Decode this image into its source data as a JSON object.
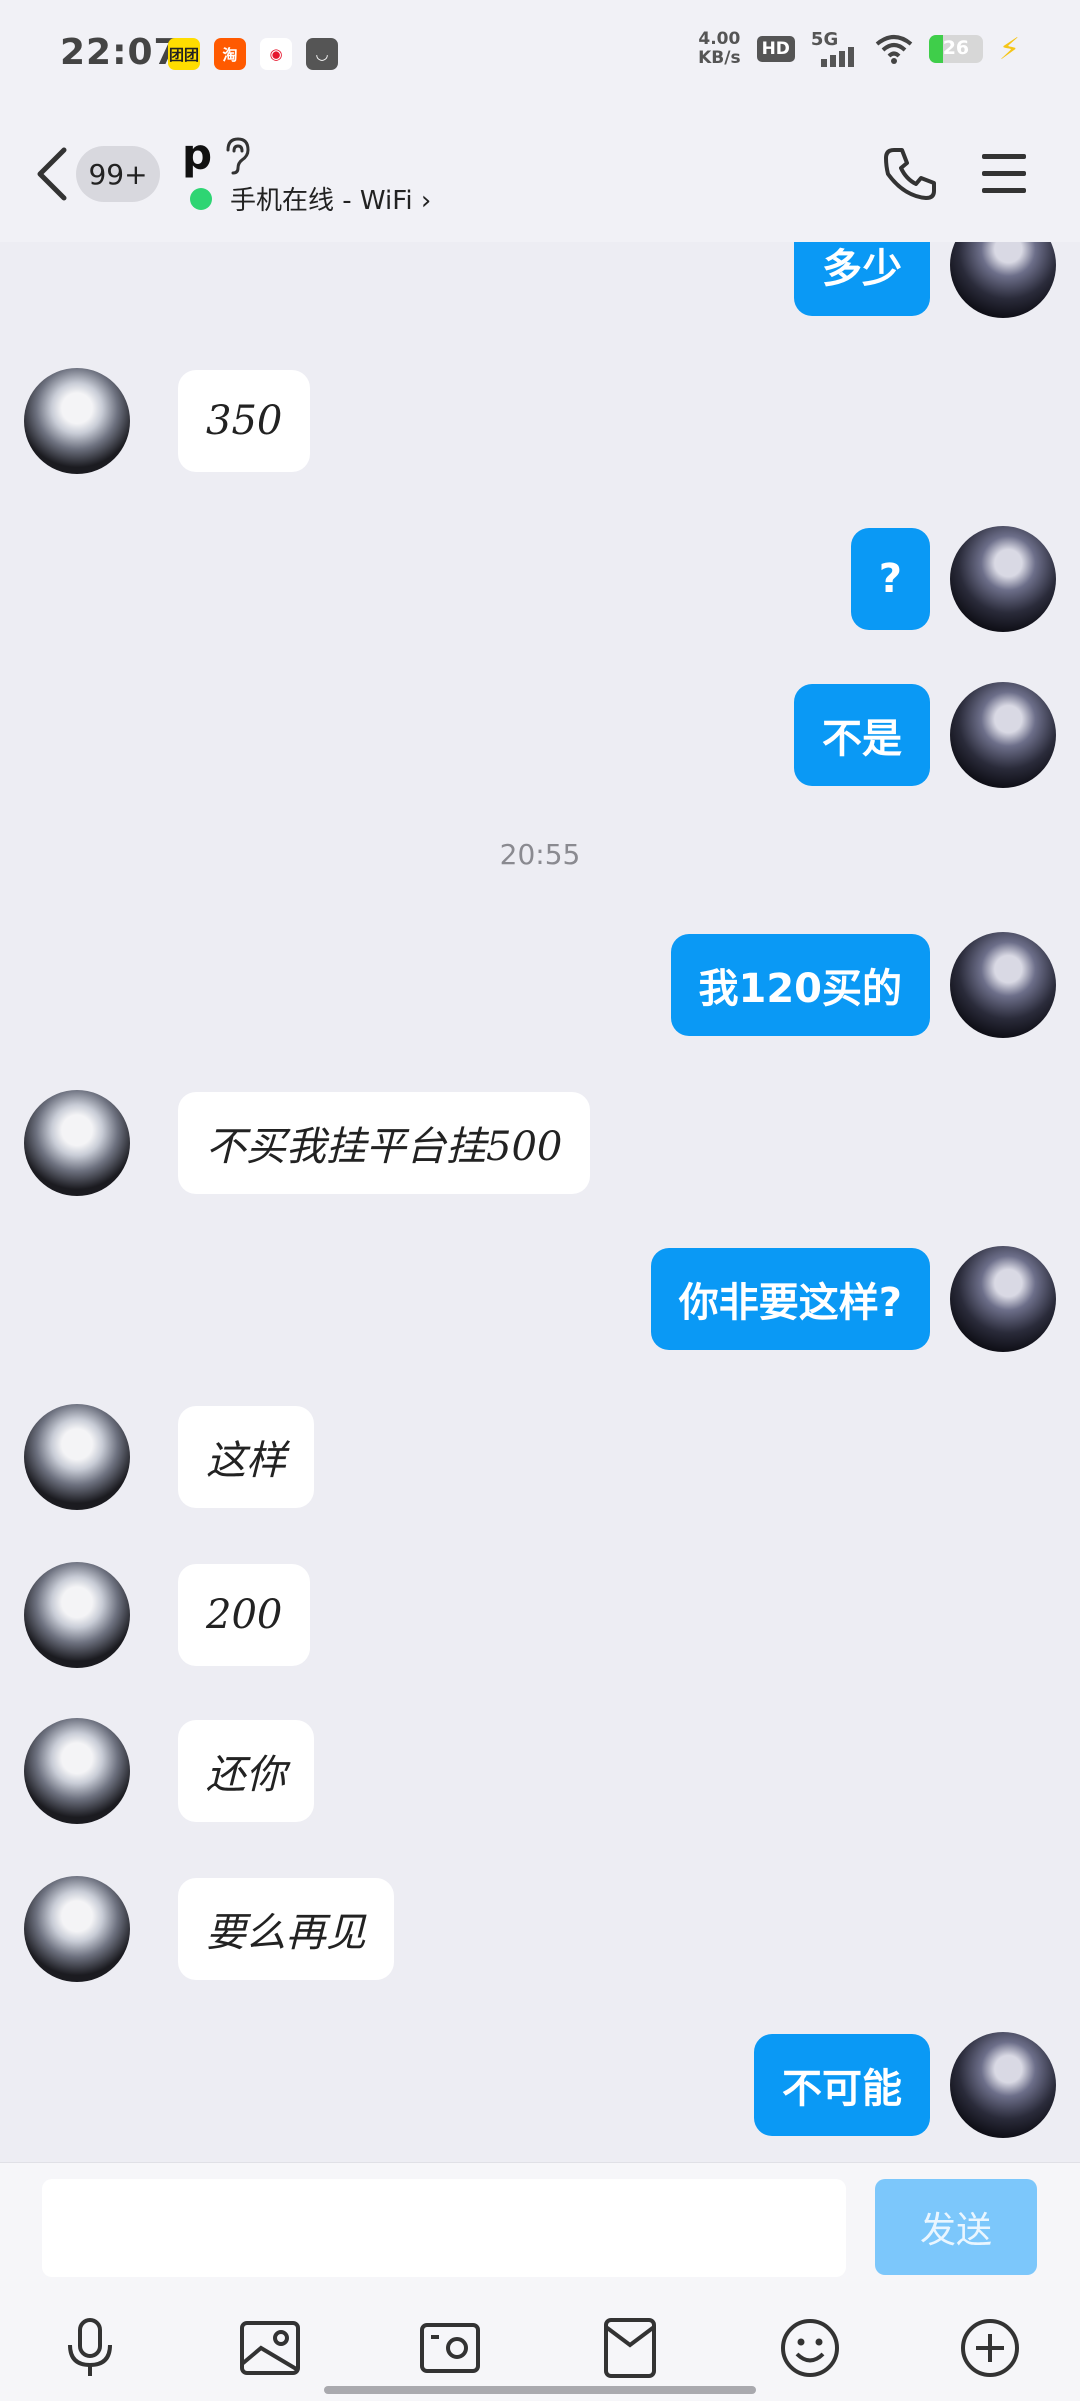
{
  "status_bar": {
    "time": "22:07",
    "app_icons": [
      {
        "name": "meituan-app-icon",
        "label": "团团",
        "bg": "#ffdd00",
        "fg": "#222"
      },
      {
        "name": "taobao-app-icon",
        "label": "淘",
        "bg": "#ff5a00",
        "fg": "#fff"
      },
      {
        "name": "weibo-app-icon",
        "label": "◉",
        "bg": "#ffffff",
        "fg": "#e6162d"
      },
      {
        "name": "bag-app-icon",
        "label": "◡",
        "bg": "#555555",
        "fg": "#fff"
      }
    ],
    "net_speed": "4.00",
    "net_unit": "KB/s",
    "hd": "HD",
    "signal": "5G",
    "battery": "26",
    "battery_level": 0.26,
    "charging": true
  },
  "header": {
    "unread_badge": "99+",
    "contact_name": "p",
    "status": "手机在线 - WiFi",
    "status_color": "#2ed573"
  },
  "messages": [
    {
      "side": "me",
      "text": "多少"
    },
    {
      "side": "peer",
      "text": "350"
    },
    {
      "side": "me",
      "text": "?"
    },
    {
      "side": "me",
      "text": "不是"
    },
    {
      "side": "time",
      "text": "20:55"
    },
    {
      "side": "me",
      "text": "我120买的"
    },
    {
      "side": "peer",
      "text": "不买我挂平台挂500"
    },
    {
      "side": "me",
      "text": "你非要这样?"
    },
    {
      "side": "peer",
      "text": "这样"
    },
    {
      "side": "peer",
      "text": "200"
    },
    {
      "side": "peer",
      "text": "还你"
    },
    {
      "side": "peer",
      "text": "要么再见"
    },
    {
      "side": "me",
      "text": "不可能"
    }
  ],
  "composer": {
    "input_value": "",
    "send_label": "发送",
    "tools": [
      "microphone-icon",
      "image-icon",
      "camera-icon",
      "red-packet-icon",
      "emoji-icon",
      "plus-icon"
    ]
  },
  "colors": {
    "accent": "#0a99f5",
    "background": "#ededf3",
    "send_disabled": "#7cc7fb"
  }
}
